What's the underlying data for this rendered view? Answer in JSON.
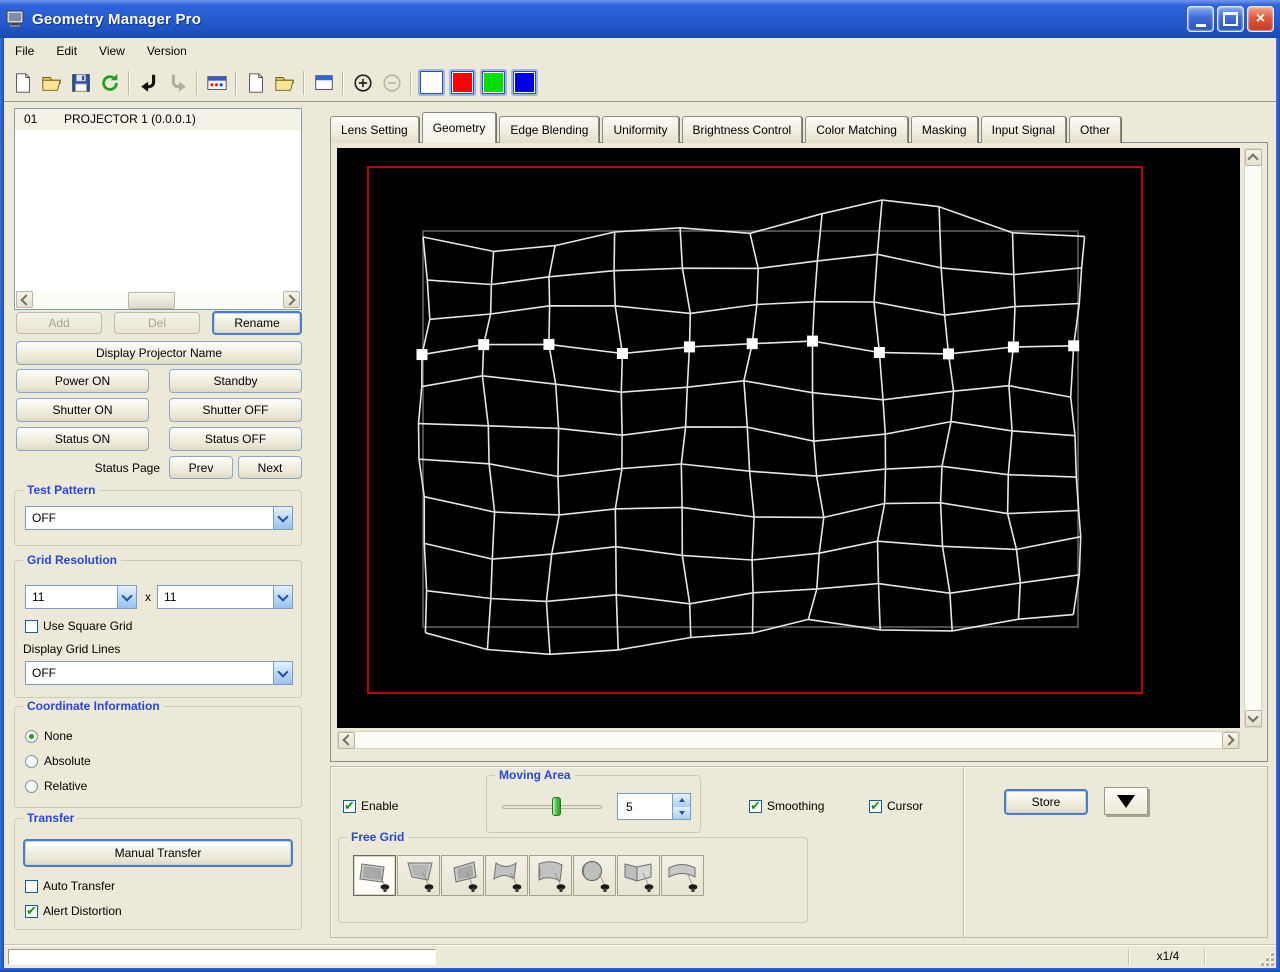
{
  "window": {
    "title": "Geometry Manager Pro",
    "controls": {
      "minimize": "minimize",
      "maximize": "maximize",
      "close": "close"
    }
  },
  "menu": {
    "items": [
      "File",
      "Edit",
      "View",
      "Version"
    ]
  },
  "toolbar": {
    "items": [
      {
        "name": "new-file-icon"
      },
      {
        "name": "open-file-icon"
      },
      {
        "name": "save-icon"
      },
      {
        "name": "refresh-icon"
      },
      {
        "sep": true
      },
      {
        "name": "undo-icon"
      },
      {
        "name": "redo-icon",
        "disabled": true
      },
      {
        "sep": true
      },
      {
        "name": "projector-status-icon"
      },
      {
        "sep": true
      },
      {
        "name": "new-window-icon"
      },
      {
        "name": "open-window-icon"
      },
      {
        "sep": true
      },
      {
        "name": "window-icon"
      },
      {
        "sep": true
      },
      {
        "name": "zoom-in-icon"
      },
      {
        "name": "zoom-out-icon",
        "disabled": true
      },
      {
        "sep": true
      },
      {
        "name": "white-screen-button",
        "color": "#FFFFFF"
      },
      {
        "name": "red-screen-button",
        "color": "#FF0000"
      },
      {
        "name": "green-screen-button",
        "color": "#00DD00"
      },
      {
        "name": "blue-screen-button",
        "color": "#0000E6"
      }
    ]
  },
  "sidebar": {
    "projector_list": {
      "items": [
        {
          "index": "01",
          "name": "PROJECTOR 1 (0.0.0.1)",
          "selected": true
        }
      ]
    },
    "list_buttons": {
      "add": {
        "label": "Add",
        "enabled": false
      },
      "del": {
        "label": "Del",
        "enabled": false
      },
      "rename": {
        "label": "Rename",
        "enabled": true
      }
    },
    "display_projector_name": "Display Projector Name",
    "power_on": "Power ON",
    "standby": "Standby",
    "shutter_on": "Shutter ON",
    "shutter_off": "Shutter OFF",
    "status_on": "Status ON",
    "status_off": "Status OFF",
    "status_page": {
      "label": "Status Page",
      "prev": "Prev",
      "next": "Next"
    },
    "test_pattern": {
      "label": "Test Pattern",
      "value": "OFF"
    },
    "grid_resolution": {
      "label": "Grid Resolution",
      "horizontal": "11",
      "separator": "x",
      "vertical": "11",
      "use_square_grid": {
        "label": "Use Square Grid",
        "checked": false
      },
      "display_grid_lines_label": "Display Grid Lines",
      "display_grid_lines_value": "OFF"
    },
    "coordinate_information": {
      "label": "Coordinate Information",
      "options": [
        {
          "label": "None",
          "selected": true
        },
        {
          "label": "Absolute",
          "selected": false
        },
        {
          "label": "Relative",
          "selected": false
        }
      ]
    },
    "transfer": {
      "label": "Transfer",
      "manual": "Manual Transfer",
      "auto": {
        "label": "Auto Transfer",
        "checked": false
      },
      "alert": {
        "label": "Alert Distortion",
        "checked": true
      }
    }
  },
  "tabs": {
    "items": [
      {
        "label": "Lens Setting",
        "active": false
      },
      {
        "label": "Geometry",
        "active": true
      },
      {
        "label": "Edge Blending",
        "active": false
      },
      {
        "label": "Uniformity",
        "active": false
      },
      {
        "label": "Brightness Control",
        "active": false
      },
      {
        "label": "Color Matching",
        "active": false
      },
      {
        "label": "Masking",
        "active": false
      },
      {
        "label": "Input Signal",
        "active": false
      },
      {
        "label": "Other",
        "active": false
      }
    ]
  },
  "canvas": {
    "grid": {
      "cols": 11,
      "rows": 11,
      "marker_row": 3,
      "seed": 11,
      "bg": "#000000",
      "outline_color": "#BE0000",
      "reference_color": "#4E4E4E",
      "line_color": "#E6E6E6",
      "marker_color": "#FFFFFF"
    }
  },
  "bottom_panel": {
    "enable": {
      "label": "Enable",
      "checked": true
    },
    "moving_area": {
      "label": "Moving Area",
      "value": "5"
    },
    "smoothing": {
      "label": "Smoothing",
      "checked": true
    },
    "cursor": {
      "label": "Cursor",
      "checked": true
    },
    "store": "Store",
    "free_grid": {
      "label": "Free Grid",
      "selected": 0,
      "buttons": [
        "flat-screen",
        "flat-screen-tilt",
        "screen-lean-back",
        "cylinder-concave",
        "cylinder-column",
        "sphere",
        "corner-screen",
        "curved-screen"
      ]
    }
  },
  "status_bar": {
    "zoom_level": "x1/4"
  }
}
